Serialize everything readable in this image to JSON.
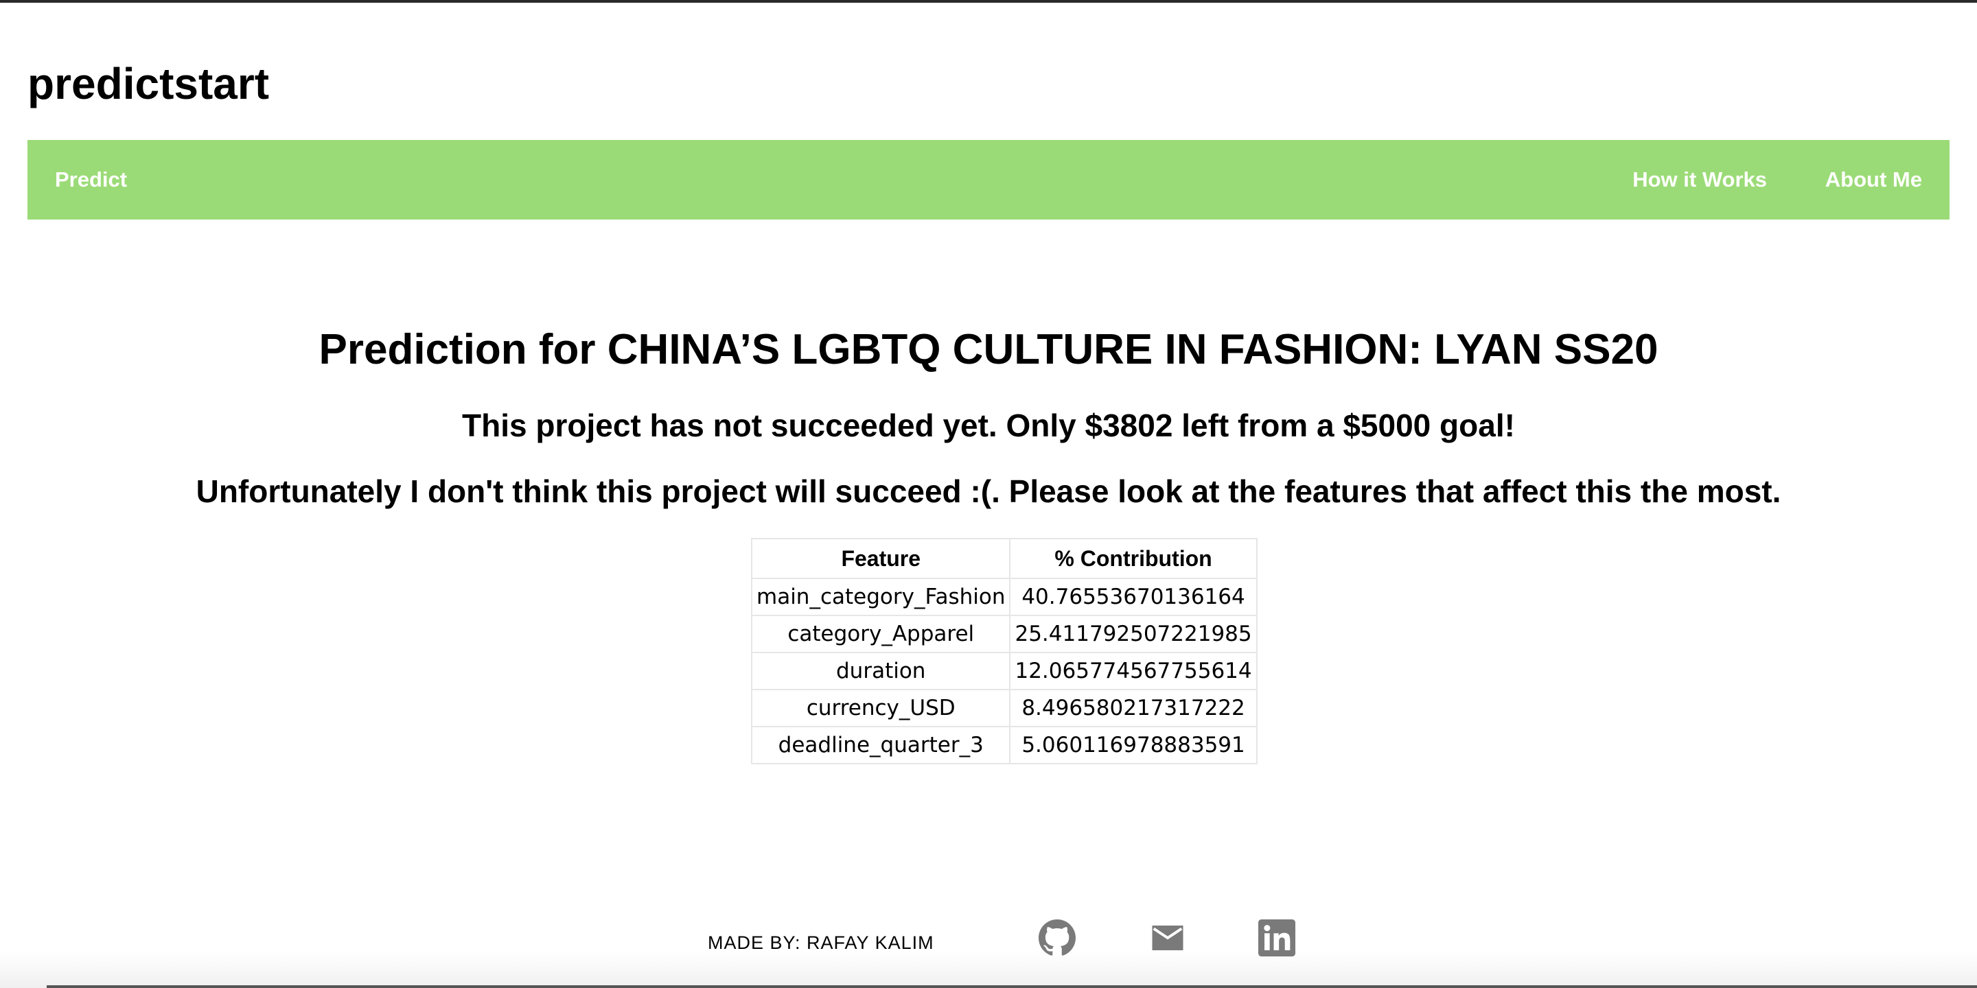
{
  "site": {
    "title": "predictstart"
  },
  "nav": {
    "left_items": [
      {
        "label": "Predict"
      }
    ],
    "right_items": [
      {
        "label": "How it Works"
      },
      {
        "label": "About Me"
      }
    ],
    "color": "#9bdb77"
  },
  "prediction": {
    "heading": "Prediction for CHINA’S LGBTQ CULTURE IN FASHION: LYAN SS20",
    "status": "This project has not succeeded yet. Only $3802 left from a $5000 goal!",
    "verdict": "Unfortunately I don't think this project will succeed :(. Please look at the features that affect this the most."
  },
  "features_table": {
    "headers": [
      "Feature",
      "% Contribution"
    ],
    "rows": [
      {
        "feature": "main_category_Fashion",
        "contribution": "40.76553670136164"
      },
      {
        "feature": "category_Apparel",
        "contribution": "25.411792507221985"
      },
      {
        "feature": "duration",
        "contribution": "12.065774567755614"
      },
      {
        "feature": "currency_USD",
        "contribution": "8.496580217317222"
      },
      {
        "feature": "deadline_quarter_3",
        "contribution": "5.060116978883591"
      }
    ]
  },
  "footer": {
    "credit": "MADE BY: RAFAY KALIM",
    "icons": [
      "github-icon",
      "mail-icon",
      "linkedin-icon"
    ],
    "icon_color": "#7a7a7a"
  }
}
